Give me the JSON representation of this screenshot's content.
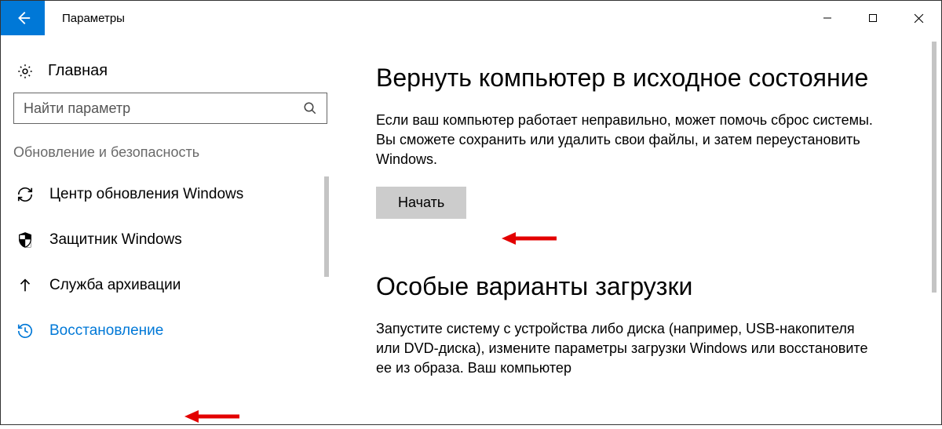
{
  "titlebar": {
    "app_title": "Параметры"
  },
  "sidebar": {
    "home_label": "Главная",
    "search_placeholder": "Найти параметр",
    "category": "Обновление и безопасность",
    "items": [
      {
        "label": "Центр обновления Windows",
        "icon": "sync-icon"
      },
      {
        "label": "Защитник Windows",
        "icon": "shield-icon"
      },
      {
        "label": "Служба архивации",
        "icon": "upload-icon"
      },
      {
        "label": "Восстановление",
        "icon": "history-icon",
        "active": true
      }
    ]
  },
  "main": {
    "reset": {
      "heading": "Вернуть компьютер в исходное состояние",
      "description": "Если ваш компьютер работает неправильно, может помочь сброс системы. Вы сможете сохранить или удалить свои файлы, и затем переустановить Windows.",
      "button_label": "Начать"
    },
    "advanced": {
      "heading": "Особые варианты загрузки",
      "description": "Запустите систему с устройства либо диска (например, USB-накопителя или DVD-диска), измените параметры загрузки Windows или восстановите ее из образа. Ваш компьютер"
    }
  }
}
